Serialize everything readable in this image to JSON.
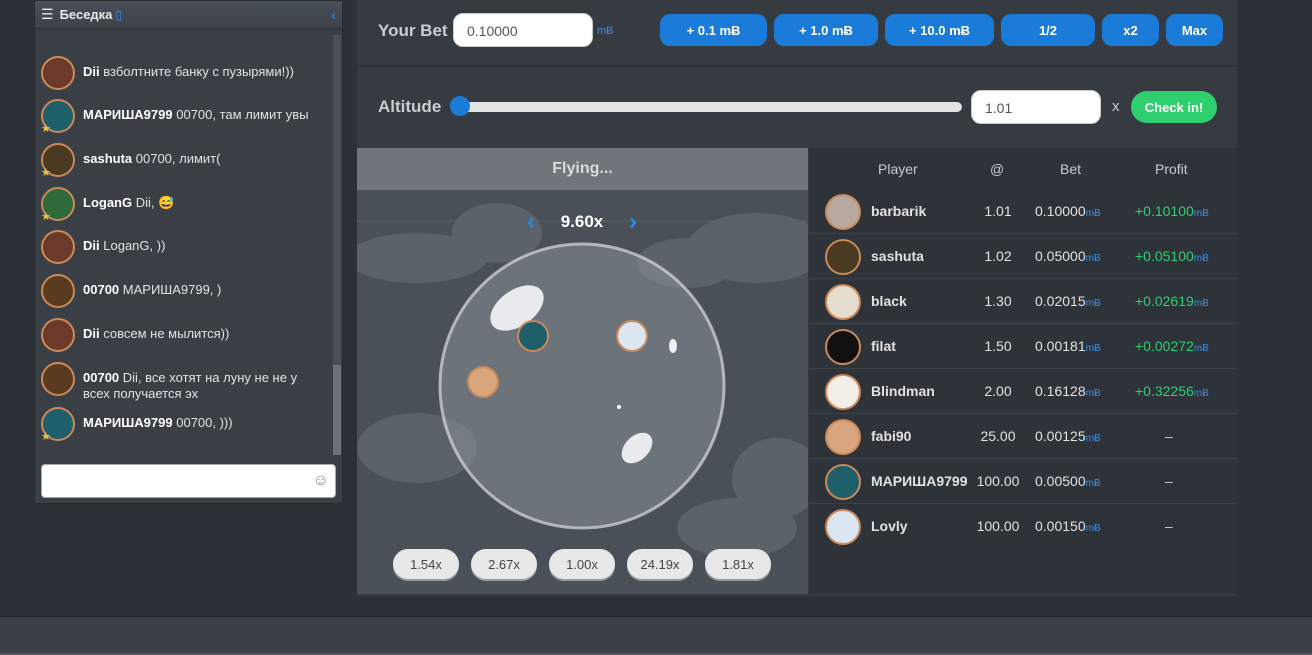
{
  "chat": {
    "title": "Беседка",
    "messages": [
      {
        "user": "Dii",
        "text": "взболтните банку с пузырями!))"
      },
      {
        "user": "МАРИША9799",
        "text": "00700, там лимит увы"
      },
      {
        "user": "sashuta",
        "text": "00700, лимит("
      },
      {
        "user": "LoganG",
        "text": "Dii, 😅"
      },
      {
        "user": "Dii",
        "text": "LoganG, ))"
      },
      {
        "user": "00700",
        "text": "МАРИША9799, )"
      },
      {
        "user": "Dii",
        "text": "совсем не мылится))"
      },
      {
        "user": "00700",
        "text": "Dii, все хотят на луну не не у всех получается эх"
      },
      {
        "user": "МАРИША9799",
        "text": "00700, )))"
      }
    ],
    "input_placeholder": ""
  },
  "bet": {
    "label": "Your Bet",
    "value": "0.10000",
    "unit": "mɃ",
    "buttons": [
      "+ 0.1 mɃ",
      "+ 1.0 mɃ",
      "+ 10.0 mɃ",
      "1/2",
      "x2",
      "Max"
    ]
  },
  "altitude": {
    "label": "Altitude",
    "value": "1.01",
    "x_label": "x",
    "check_in": "Check in!"
  },
  "game": {
    "status": "Flying...",
    "multiplier": "9.60x",
    "history": [
      "1.54x",
      "2.67x",
      "1.00x",
      "24.19x",
      "1.81x"
    ]
  },
  "table": {
    "headers": [
      "Player",
      "@",
      "Bet",
      "Profit"
    ],
    "unit": "mɃ",
    "rows": [
      {
        "player": "barbarik",
        "at": "1.01",
        "bet": "0.10000",
        "profit": "+0.10100"
      },
      {
        "player": "sashuta",
        "at": "1.02",
        "bet": "0.05000",
        "profit": "+0.05100"
      },
      {
        "player": "black",
        "at": "1.30",
        "bet": "0.02015",
        "profit": "+0.02619"
      },
      {
        "player": "filat",
        "at": "1.50",
        "bet": "0.00181",
        "profit": "+0.00272"
      },
      {
        "player": "Blindman",
        "at": "2.00",
        "bet": "0.16128",
        "profit": "+0.32256"
      },
      {
        "player": "fabi90",
        "at": "25.00",
        "bet": "0.00125",
        "profit": "–"
      },
      {
        "player": "МАРИША9799",
        "at": "100.00",
        "bet": "0.00500",
        "profit": "–"
      },
      {
        "player": "Lovly",
        "at": "100.00",
        "bet": "0.00150",
        "profit": "–"
      }
    ]
  },
  "colors": {
    "accent": "#1a7bd8",
    "success": "#2fcf6f",
    "panel": "#343941"
  }
}
